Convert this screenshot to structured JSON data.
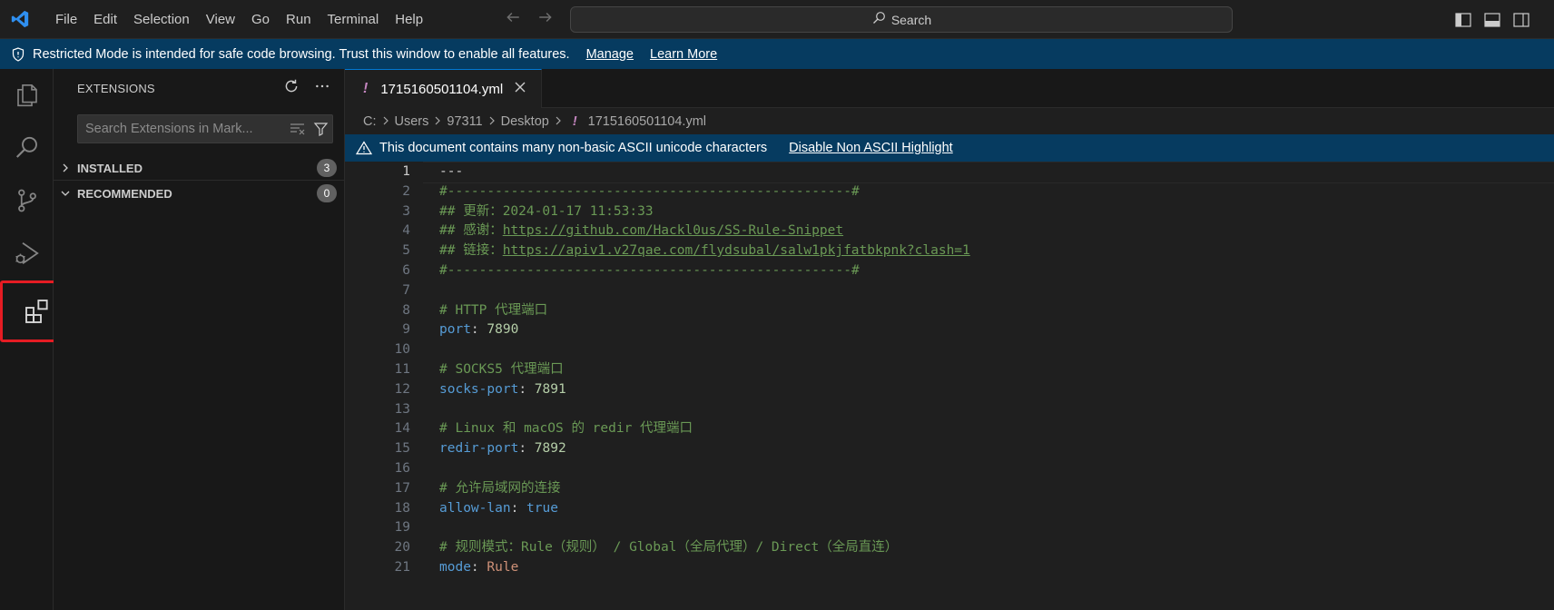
{
  "titlebar": {
    "menu": [
      "File",
      "Edit",
      "Selection",
      "View",
      "Go",
      "Run",
      "Terminal",
      "Help"
    ],
    "search_label": "Search"
  },
  "banner": {
    "message": "Restricted Mode is intended for safe code browsing. Trust this window to enable all features.",
    "manage": "Manage",
    "learn_more": "Learn More"
  },
  "sidebar": {
    "title": "EXTENSIONS",
    "search_placeholder": "Search Extensions in Mark...",
    "sections": [
      {
        "label": "INSTALLED",
        "count": "3",
        "expanded": false
      },
      {
        "label": "RECOMMENDED",
        "count": "0",
        "expanded": true
      }
    ]
  },
  "editor": {
    "tab": {
      "warn": "!",
      "name": "1715160501104.yml"
    },
    "breadcrumb": [
      "C:",
      "Users",
      "97311",
      "Desktop",
      "1715160501104.yml"
    ],
    "ascii_notice": {
      "message": "This document contains many non-basic ASCII unicode characters",
      "action": "Disable Non ASCII Highlight"
    },
    "lines": [
      {
        "n": "1",
        "parts": [
          [
            "c-plain",
            "---"
          ]
        ]
      },
      {
        "n": "2",
        "parts": [
          [
            "c-comment",
            "#---------------------------------------------------#"
          ]
        ]
      },
      {
        "n": "3",
        "parts": [
          [
            "c-comment",
            "## 更新：2024-01-17 11:53:33"
          ]
        ]
      },
      {
        "n": "4",
        "parts": [
          [
            "c-comment",
            "## 感谢："
          ],
          [
            "c-link",
            "https://github.com/Hackl0us/SS-Rule-Snippet"
          ]
        ]
      },
      {
        "n": "5",
        "parts": [
          [
            "c-comment",
            "## 链接："
          ],
          [
            "c-link",
            "https://apiv1.v27qae.com/flydsubal/salw1pkjfatbkpnk?clash=1"
          ]
        ]
      },
      {
        "n": "6",
        "parts": [
          [
            "c-comment",
            "#---------------------------------------------------#"
          ]
        ]
      },
      {
        "n": "7",
        "parts": []
      },
      {
        "n": "8",
        "parts": [
          [
            "c-comment",
            "# HTTP 代理端口"
          ]
        ]
      },
      {
        "n": "9",
        "parts": [
          [
            "c-key",
            "port"
          ],
          [
            "c-punct",
            ": "
          ],
          [
            "c-num",
            "7890"
          ]
        ]
      },
      {
        "n": "10",
        "parts": []
      },
      {
        "n": "11",
        "parts": [
          [
            "c-comment",
            "# SOCKS5 代理端口"
          ]
        ]
      },
      {
        "n": "12",
        "parts": [
          [
            "c-key",
            "socks-port"
          ],
          [
            "c-punct",
            ": "
          ],
          [
            "c-num",
            "7891"
          ]
        ]
      },
      {
        "n": "13",
        "parts": []
      },
      {
        "n": "14",
        "parts": [
          [
            "c-comment",
            "# Linux 和 macOS 的 redir 代理端口"
          ]
        ]
      },
      {
        "n": "15",
        "parts": [
          [
            "c-key",
            "redir-port"
          ],
          [
            "c-punct",
            ": "
          ],
          [
            "c-num",
            "7892"
          ]
        ]
      },
      {
        "n": "16",
        "parts": []
      },
      {
        "n": "17",
        "parts": [
          [
            "c-comment",
            "# 允许局域网的连接"
          ]
        ]
      },
      {
        "n": "18",
        "parts": [
          [
            "c-key",
            "allow-lan"
          ],
          [
            "c-punct",
            ": "
          ],
          [
            "c-bool",
            "true"
          ]
        ]
      },
      {
        "n": "19",
        "parts": []
      },
      {
        "n": "20",
        "parts": [
          [
            "c-comment",
            "# 规则模式：Rule（规则） / Global（全局代理）/ Direct（全局直连）"
          ]
        ]
      },
      {
        "n": "21",
        "parts": [
          [
            "c-key",
            "mode"
          ],
          [
            "c-punct",
            ": "
          ],
          [
            "c-str",
            "Rule"
          ]
        ]
      }
    ]
  }
}
